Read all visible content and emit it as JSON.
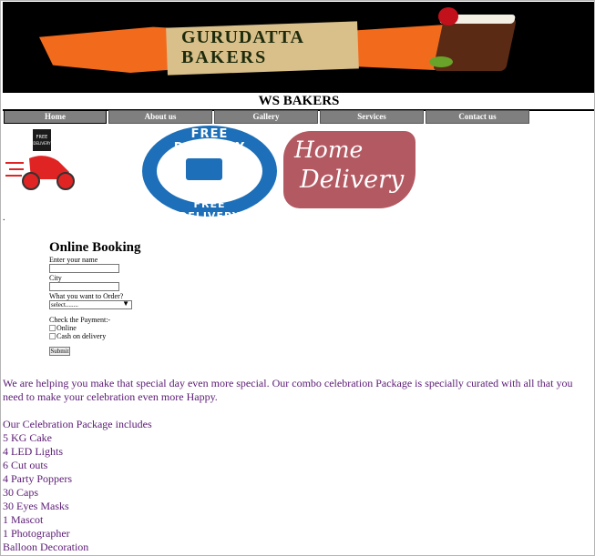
{
  "banner": {
    "line1": "GURUDATTA",
    "line2": "BAKERS"
  },
  "site_title": "WS BAKERS",
  "nav": [
    {
      "label": "Home"
    },
    {
      "label": "About us"
    },
    {
      "label": "Gallery"
    },
    {
      "label": "Services"
    },
    {
      "label": "Contact us"
    }
  ],
  "images": {
    "scooter_label": "FREE DELIVERY",
    "badge_top": "FREE DELIVERY",
    "badge_bottom": "FREE DELIVERY",
    "home_delivery_1": "Home",
    "home_delivery_2": "Delivery"
  },
  "form": {
    "title": "Online Booking",
    "name_label": "Enter your name",
    "name_value": "",
    "city_label": "City",
    "city_value": "",
    "order_label": "What you want to Order?",
    "order_selected": "select........",
    "payment_label": "Check the Payment:-",
    "payment_options": [
      "Online",
      "Cash on delivery"
    ],
    "submit_label": "Submit"
  },
  "intro": "We are helping you make that special day even more special. Our combo celebration Package is specially curated with all that you need to make your celebration even more Happy.",
  "package": {
    "heading": "Our Celebration Package includes",
    "items": [
      "5 KG Cake",
      "4 LED Lights",
      "6 Cut outs",
      "4 Party Poppers",
      "30 Caps",
      "30 Eyes Masks",
      "1 Mascot",
      "1 Photographer",
      "Balloon Decoration"
    ]
  },
  "colors": {
    "nav_bg": "#7f7f7f",
    "content_text": "#5a1a74",
    "banner_orange": "#f26b1d",
    "badge_blue": "#1c6fb8",
    "home_delivery": "#b35962"
  }
}
